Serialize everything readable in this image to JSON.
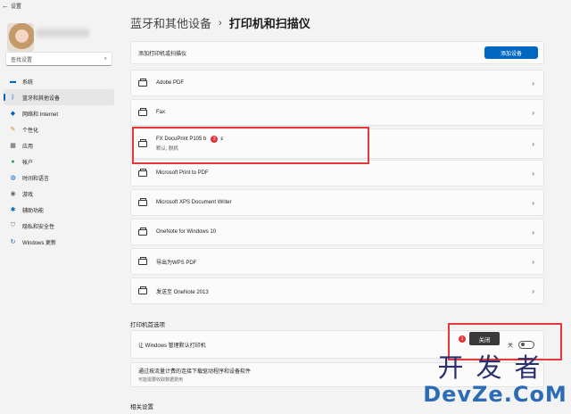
{
  "window": {
    "title": "设置"
  },
  "sidebar": {
    "search_placeholder": "查找设置",
    "items": [
      {
        "label": "系统",
        "icon": "monitor-icon"
      },
      {
        "label": "蓝牙和其他设备",
        "icon": "bluetooth-icon",
        "active": true
      },
      {
        "label": "网络和 Internet",
        "icon": "wifi-icon"
      },
      {
        "label": "个性化",
        "icon": "pen-icon"
      },
      {
        "label": "应用",
        "icon": "apps-icon"
      },
      {
        "label": "帐户",
        "icon": "account-icon"
      },
      {
        "label": "时间和语言",
        "icon": "globe-icon"
      },
      {
        "label": "游戏",
        "icon": "gamepad-icon"
      },
      {
        "label": "辅助功能",
        "icon": "accessibility-icon"
      },
      {
        "label": "隐私和安全性",
        "icon": "shield-icon"
      },
      {
        "label": "Windows 更新",
        "icon": "update-icon"
      }
    ]
  },
  "header": {
    "breadcrumb_parent": "蓝牙和其他设备",
    "separator": "›",
    "title": "打印机和扫描仪"
  },
  "add_device": {
    "label": "添加打印机或扫描仪",
    "button": "添加设备"
  },
  "printers": [
    {
      "name": "Adobe PDF",
      "status": ""
    },
    {
      "name": "Fax",
      "status": ""
    },
    {
      "name": "FX DocuPrint P105 b",
      "status": "默认, 脱机",
      "annotation": "2",
      "cursor": "ɛ"
    },
    {
      "name": "Microsoft Print to PDF",
      "status": ""
    },
    {
      "name": "Microsoft XPS Document Writer",
      "status": ""
    },
    {
      "name": "OneNote for Windows 10",
      "status": ""
    },
    {
      "name": "导出为WPS PDF",
      "status": ""
    },
    {
      "name": "发送至 OneNote 2013",
      "status": ""
    }
  ],
  "preferences": {
    "section_title": "打印机首选项",
    "default_label": "让 Windows 管理默认打印机",
    "toggle_state": "关",
    "tooltip": "关闭",
    "annotation": "1",
    "metered_title": "通过按流量计费的连接下载驱动程序和设备软件",
    "metered_sub": "可能需要收取数据费用"
  },
  "related": {
    "title": "相关设置"
  },
  "watermark": {
    "top": "开发者",
    "bottom": "DevZe.CoM"
  },
  "colors": {
    "accent": "#0067c0",
    "highlight": "#e5383b",
    "badge": "#e0343a"
  }
}
